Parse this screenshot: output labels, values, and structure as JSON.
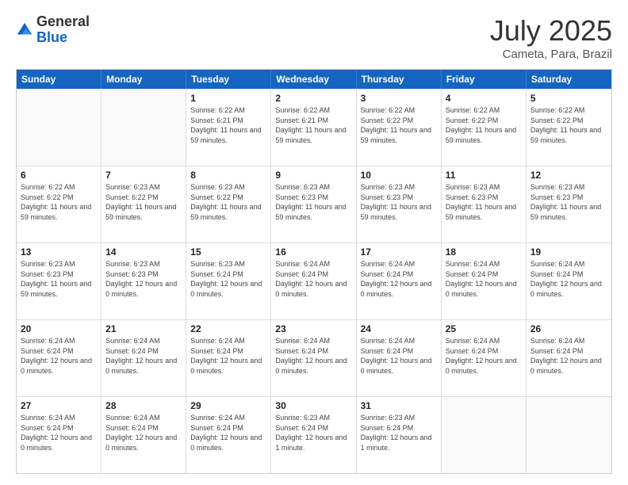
{
  "header": {
    "logo": {
      "general": "General",
      "blue": "Blue"
    },
    "title": "July 2025",
    "location": "Cameta, Para, Brazil"
  },
  "days_of_week": [
    "Sunday",
    "Monday",
    "Tuesday",
    "Wednesday",
    "Thursday",
    "Friday",
    "Saturday"
  ],
  "weeks": [
    [
      {
        "day": "",
        "info": ""
      },
      {
        "day": "",
        "info": ""
      },
      {
        "day": "1",
        "info": "Sunrise: 6:22 AM\nSunset: 6:21 PM\nDaylight: 11 hours and 59 minutes."
      },
      {
        "day": "2",
        "info": "Sunrise: 6:22 AM\nSunset: 6:21 PM\nDaylight: 11 hours and 59 minutes."
      },
      {
        "day": "3",
        "info": "Sunrise: 6:22 AM\nSunset: 6:22 PM\nDaylight: 11 hours and 59 minutes."
      },
      {
        "day": "4",
        "info": "Sunrise: 6:22 AM\nSunset: 6:22 PM\nDaylight: 11 hours and 59 minutes."
      },
      {
        "day": "5",
        "info": "Sunrise: 6:22 AM\nSunset: 6:22 PM\nDaylight: 11 hours and 59 minutes."
      }
    ],
    [
      {
        "day": "6",
        "info": "Sunrise: 6:22 AM\nSunset: 6:22 PM\nDaylight: 11 hours and 59 minutes."
      },
      {
        "day": "7",
        "info": "Sunrise: 6:23 AM\nSunset: 6:22 PM\nDaylight: 11 hours and 59 minutes."
      },
      {
        "day": "8",
        "info": "Sunrise: 6:23 AM\nSunset: 6:22 PM\nDaylight: 11 hours and 59 minutes."
      },
      {
        "day": "9",
        "info": "Sunrise: 6:23 AM\nSunset: 6:23 PM\nDaylight: 11 hours and 59 minutes."
      },
      {
        "day": "10",
        "info": "Sunrise: 6:23 AM\nSunset: 6:23 PM\nDaylight: 11 hours and 59 minutes."
      },
      {
        "day": "11",
        "info": "Sunrise: 6:23 AM\nSunset: 6:23 PM\nDaylight: 11 hours and 59 minutes."
      },
      {
        "day": "12",
        "info": "Sunrise: 6:23 AM\nSunset: 6:23 PM\nDaylight: 11 hours and 59 minutes."
      }
    ],
    [
      {
        "day": "13",
        "info": "Sunrise: 6:23 AM\nSunset: 6:23 PM\nDaylight: 11 hours and 59 minutes."
      },
      {
        "day": "14",
        "info": "Sunrise: 6:23 AM\nSunset: 6:23 PM\nDaylight: 12 hours and 0 minutes."
      },
      {
        "day": "15",
        "info": "Sunrise: 6:23 AM\nSunset: 6:24 PM\nDaylight: 12 hours and 0 minutes."
      },
      {
        "day": "16",
        "info": "Sunrise: 6:24 AM\nSunset: 6:24 PM\nDaylight: 12 hours and 0 minutes."
      },
      {
        "day": "17",
        "info": "Sunrise: 6:24 AM\nSunset: 6:24 PM\nDaylight: 12 hours and 0 minutes."
      },
      {
        "day": "18",
        "info": "Sunrise: 6:24 AM\nSunset: 6:24 PM\nDaylight: 12 hours and 0 minutes."
      },
      {
        "day": "19",
        "info": "Sunrise: 6:24 AM\nSunset: 6:24 PM\nDaylight: 12 hours and 0 minutes."
      }
    ],
    [
      {
        "day": "20",
        "info": "Sunrise: 6:24 AM\nSunset: 6:24 PM\nDaylight: 12 hours and 0 minutes."
      },
      {
        "day": "21",
        "info": "Sunrise: 6:24 AM\nSunset: 6:24 PM\nDaylight: 12 hours and 0 minutes."
      },
      {
        "day": "22",
        "info": "Sunrise: 6:24 AM\nSunset: 6:24 PM\nDaylight: 12 hours and 0 minutes."
      },
      {
        "day": "23",
        "info": "Sunrise: 6:24 AM\nSunset: 6:24 PM\nDaylight: 12 hours and 0 minutes."
      },
      {
        "day": "24",
        "info": "Sunrise: 6:24 AM\nSunset: 6:24 PM\nDaylight: 12 hours and 0 minutes."
      },
      {
        "day": "25",
        "info": "Sunrise: 6:24 AM\nSunset: 6:24 PM\nDaylight: 12 hours and 0 minutes."
      },
      {
        "day": "26",
        "info": "Sunrise: 6:24 AM\nSunset: 6:24 PM\nDaylight: 12 hours and 0 minutes."
      }
    ],
    [
      {
        "day": "27",
        "info": "Sunrise: 6:24 AM\nSunset: 6:24 PM\nDaylight: 12 hours and 0 minutes."
      },
      {
        "day": "28",
        "info": "Sunrise: 6:24 AM\nSunset: 6:24 PM\nDaylight: 12 hours and 0 minutes."
      },
      {
        "day": "29",
        "info": "Sunrise: 6:24 AM\nSunset: 6:24 PM\nDaylight: 12 hours and 0 minutes."
      },
      {
        "day": "30",
        "info": "Sunrise: 6:23 AM\nSunset: 6:24 PM\nDaylight: 12 hours and 1 minute."
      },
      {
        "day": "31",
        "info": "Sunrise: 6:23 AM\nSunset: 6:24 PM\nDaylight: 12 hours and 1 minute."
      },
      {
        "day": "",
        "info": ""
      },
      {
        "day": "",
        "info": ""
      }
    ]
  ]
}
